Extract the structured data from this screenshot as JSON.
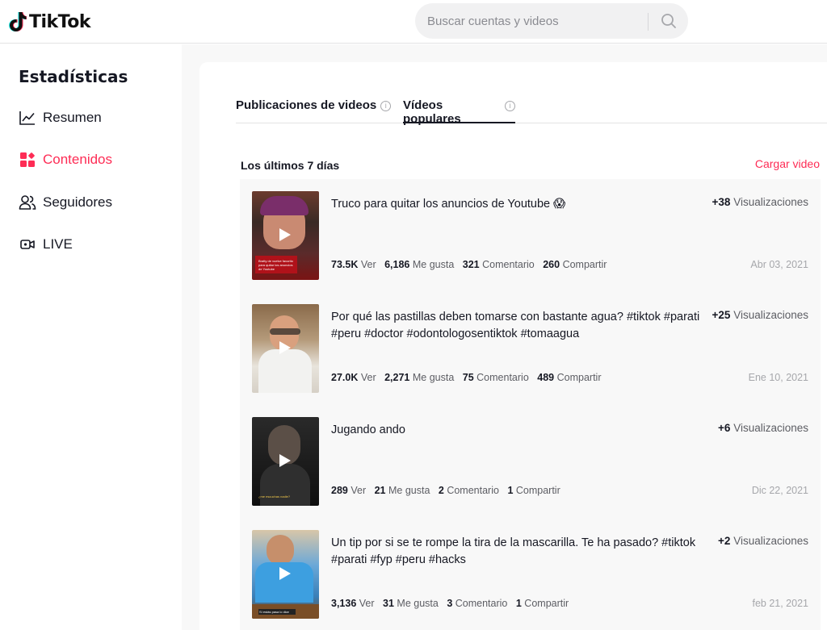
{
  "header": {
    "logo_text": "TikTok",
    "search_placeholder": "Buscar cuentas y videos",
    "search_icon": "search-icon"
  },
  "sidebar": {
    "title": "Estadísticas",
    "items": [
      {
        "label": "Resumen",
        "icon": "chart-line-icon",
        "active": false
      },
      {
        "label": "Contenidos",
        "icon": "grid-shapes-icon",
        "active": true
      },
      {
        "label": "Seguidores",
        "icon": "people-icon",
        "active": false
      },
      {
        "label": "LIVE",
        "icon": "live-camera-icon",
        "active": false
      }
    ]
  },
  "tabs": [
    {
      "label": "Publicaciones de videos",
      "info": "i",
      "active": false
    },
    {
      "label": "Vídeos populares",
      "info": "i",
      "active": true
    }
  ],
  "range_label": "Los últimos 7 días",
  "upload_label": "Cargar video",
  "colors": {
    "accent": "#fe2c55",
    "text": "#161823",
    "muted": "#5c5d63",
    "list_bg": "#f8f8f8"
  },
  "videos": [
    {
      "title": "Truco para quitar los anuncios de Youtube 😱",
      "views_delta": "+38",
      "views_label": "Visualizaciones",
      "views": "73.5K",
      "views_unit": "Ver",
      "likes": "6,186",
      "likes_unit": "Me gusta",
      "comments": "321",
      "comments_unit": "Comentario",
      "shares": "260",
      "shares_unit": "Compartir",
      "date": "Abr 03, 2021",
      "thumb_caption": "Bratty de vuelve favorito para quitar los anuncios de Youtube"
    },
    {
      "title": "Por qué las pastillas deben tomarse con bastante agua? #tiktok #parati #peru #doctor #odontologosentiktok #tomaagua",
      "views_delta": "+25",
      "views_label": "Visualizaciones",
      "views": "27.0K",
      "views_unit": "Ver",
      "likes": "2,271",
      "likes_unit": "Me gusta",
      "comments": "75",
      "comments_unit": "Comentario",
      "shares": "489",
      "shares_unit": "Compartir",
      "date": "Ene 10, 2021",
      "thumb_caption": ""
    },
    {
      "title": "Jugando ando",
      "views_delta": "+6",
      "views_label": "Visualizaciones",
      "views": "289",
      "views_unit": "Ver",
      "likes": "21",
      "likes_unit": "Me gusta",
      "comments": "2",
      "comments_unit": "Comentario",
      "shares": "1",
      "shares_unit": "Compartir",
      "date": "Dic 22, 2021",
      "thumb_caption": "¿me escuchas nadie?"
    },
    {
      "title": "Un tip por si se te rompe la tira de la mascarilla. Te ha pasado? #tiktok #parati #fyp #peru #hacks",
      "views_delta": "+2",
      "views_label": "Visualizaciones",
      "views": "3,136",
      "views_unit": "Ver",
      "likes": "31",
      "likes_unit": "Me gusta",
      "comments": "3",
      "comments_unit": "Comentario",
      "shares": "1",
      "shares_unit": "Compartir",
      "date": "feb 21, 2021",
      "thumb_caption": "Sí estás pasa lo dice"
    }
  ]
}
